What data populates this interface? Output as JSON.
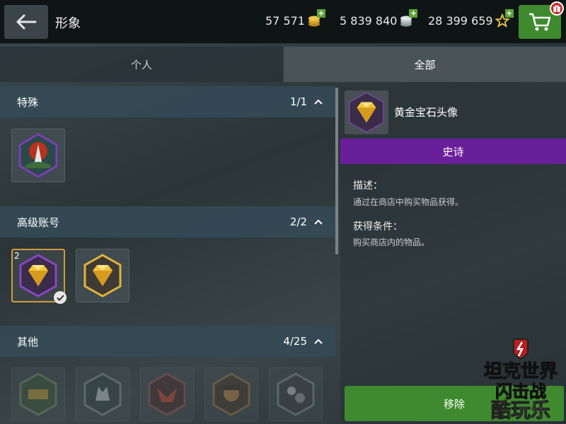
{
  "header": {
    "title": "形象",
    "currencies": [
      {
        "value": "57 571",
        "icon": "gold-coins-icon"
      },
      {
        "value": "5 839 840",
        "icon": "silver-coins-icon"
      },
      {
        "value": "28 399 659",
        "icon": "free-xp-star-icon"
      }
    ],
    "plus_label": "+"
  },
  "tabs": [
    {
      "label": "个人",
      "active": false
    },
    {
      "label": "全部",
      "active": true
    }
  ],
  "sections": [
    {
      "title": "特殊",
      "count": "1/1"
    },
    {
      "title": "高级账号",
      "count": "2/2",
      "selected_badge": "2"
    },
    {
      "title": "其他",
      "count": "4/25"
    }
  ],
  "detail": {
    "name": "黄金宝石头像",
    "rarity": "史诗",
    "desc_label": "描述：",
    "desc_text": "通过在商店中购买物品获得。",
    "cond_label": "获得条件：",
    "cond_text": "购买商店内的物品。",
    "remove_label": "移除"
  },
  "watermark": {
    "line1": "坦克世界",
    "line2": "闪击战",
    "site": "酷玩乐"
  },
  "colors": {
    "accent_green": "#3f8a2f",
    "epic_purple": "#6a1f9a",
    "gold": "#e0b43a",
    "selected_border": "#d29a3a"
  }
}
